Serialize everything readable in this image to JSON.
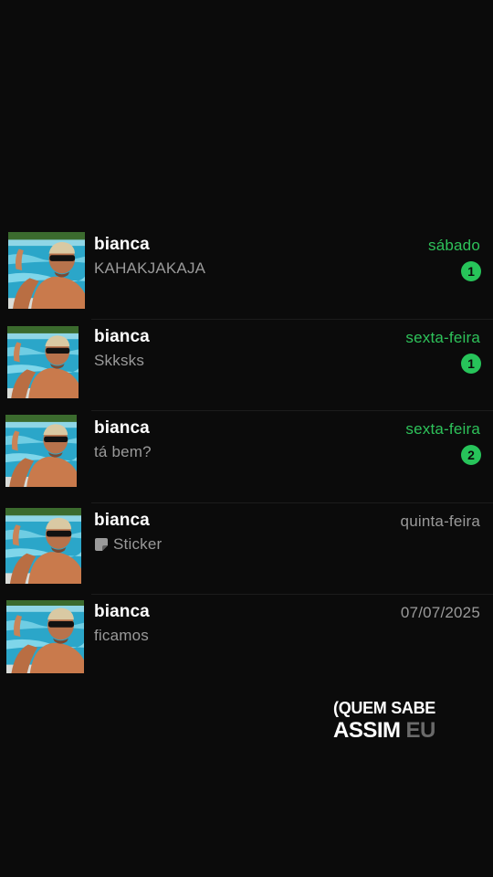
{
  "chats": [
    {
      "name": "bianca",
      "preview": "KAHAKJAKAJA",
      "time": "sábado",
      "unread_count": "1",
      "unread": true,
      "preview_icon": ""
    },
    {
      "name": "bianca",
      "preview": "Skksks",
      "time": "sexta-feira",
      "unread_count": "1",
      "unread": true,
      "preview_icon": ""
    },
    {
      "name": "bianca",
      "preview": "tá bem?",
      "time": "sexta-feira",
      "unread_count": "2",
      "unread": true,
      "preview_icon": ""
    },
    {
      "name": "bianca",
      "preview": "Sticker",
      "time": "quinta-feira",
      "unread_count": "",
      "unread": false,
      "preview_icon": "sticker-icon"
    },
    {
      "name": "bianca",
      "preview": "ficamos",
      "time": "07/07/2025",
      "unread_count": "",
      "unread": false,
      "preview_icon": ""
    }
  ],
  "caption": {
    "line1": "(QUEM SABE",
    "line2_main": "ASSIM",
    "line2_faded": "EU"
  },
  "colors": {
    "background": "#0b0b0b",
    "unread_accent": "#27c45a",
    "secondary_text": "#9a9a9a"
  }
}
